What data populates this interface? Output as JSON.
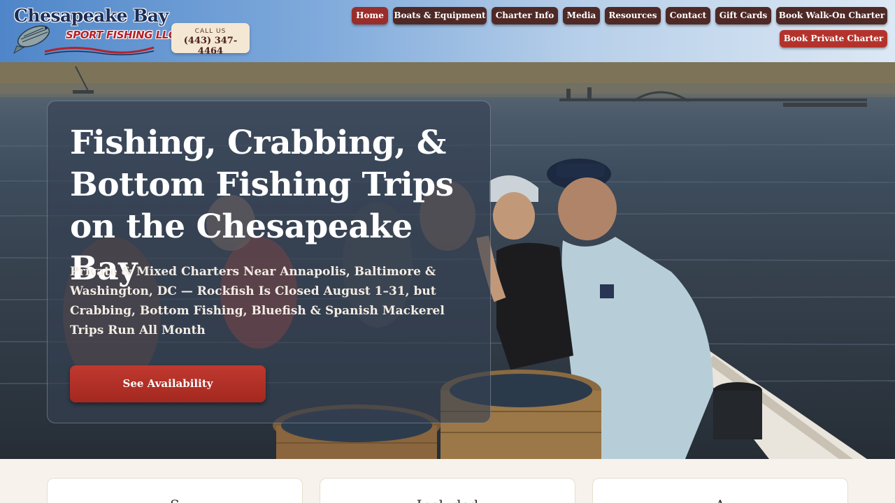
{
  "header": {
    "logo": {
      "brand_top": "Chesapeake Bay",
      "brand_bottom": "SPORT FISHING LLC"
    },
    "call": {
      "label": "CALL US",
      "number": "(443) 347-4464"
    },
    "nav": [
      {
        "label": "Home",
        "active": true
      },
      {
        "label": "Boats & Equipment",
        "active": false
      },
      {
        "label": "Charter Info",
        "active": false
      },
      {
        "label": "Media",
        "active": false
      },
      {
        "label": "Resources",
        "active": false
      },
      {
        "label": "Contact",
        "active": false
      },
      {
        "label": "Gift Cards",
        "active": false
      },
      {
        "label": "Book Walk-On Charter",
        "active": false
      }
    ],
    "cta": {
      "label": "Book Private Charter"
    }
  },
  "hero": {
    "title": "Fishing, Crabbing, & Bottom Fishing Trips on the Chesapeake Bay",
    "subtitle": "Private & Mixed Charters Near Annapolis, Baltimore & Washington, DC — Rockfish Is Closed August 1–31, but Crabbing, Bottom Fishing, Bluefish & Spanish Mackerel Trips Run All Month",
    "button": "See Availability"
  },
  "cards": [
    {
      "title": "S"
    },
    {
      "title": "Included"
    },
    {
      "title": "A"
    }
  ],
  "colors": {
    "nav_bg": "#4e2926",
    "nav_active": "#9a2d2a",
    "cta": "#b3332c",
    "header_gradient_start": "#4f86c9",
    "header_gradient_end": "#dce8f4"
  }
}
